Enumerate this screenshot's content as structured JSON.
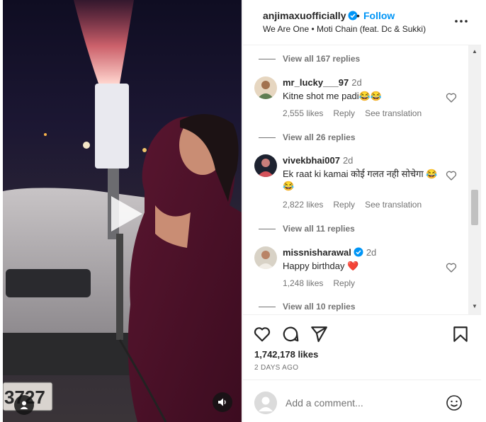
{
  "header": {
    "username": "anjimaxuofficially",
    "separator": "•",
    "follow_label": "Follow",
    "song": "We Are One • Moti Chain (feat. Dc & Sukki)"
  },
  "video": {
    "plate_text": "3727"
  },
  "comments": {
    "replies": [
      "View all 167 replies",
      "View all 26 replies",
      "View all 11 replies",
      "View all 10 replies"
    ],
    "items": [
      {
        "username": "mr_lucky___97",
        "time": "2d",
        "text": "Kitne shot me padi😂😂",
        "likes": "2,555 likes",
        "reply": "Reply",
        "translate": "See translation"
      },
      {
        "username": "vivekbhai007",
        "time": "2d",
        "text": "Ek raat ki kamai कोई गलत नही सोचेगा 😂😂",
        "likes": "2,822 likes",
        "reply": "Reply",
        "translate": "See translation"
      },
      {
        "username": "missnisharawal",
        "time": "2d",
        "text": "Happy birthday ❤️",
        "likes": "1,248 likes",
        "reply": "Reply"
      }
    ]
  },
  "post": {
    "likes": "1,742,178 likes",
    "posted": "2 DAYS AGO"
  },
  "add_comment": {
    "placeholder": "Add a comment..."
  },
  "colors": {
    "accent": "#0095f6",
    "verified": "#0095f6",
    "heart_red": "#ed4956",
    "muted_text": "#737373"
  },
  "icons": [
    "play-icon",
    "user-tag-icon",
    "volume-icon",
    "verified-icon",
    "more-icon",
    "heart-icon",
    "comment-icon",
    "share-icon",
    "bookmark-icon",
    "emoji-icon"
  ]
}
